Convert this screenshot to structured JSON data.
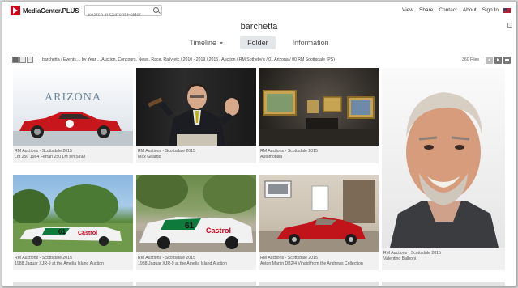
{
  "app": {
    "brand": "MediaCenter.PLUS"
  },
  "search": {
    "placeholder": "Search in Current Folder"
  },
  "topnav": {
    "view": "View",
    "share": "Share",
    "contact": "Contact",
    "about": "About",
    "signin": "Sign In"
  },
  "folder": {
    "title": "barchetta"
  },
  "tabs": {
    "timeline": "Timeline",
    "folder": "Folder",
    "information": "Information"
  },
  "toolbar": {
    "breadcrumb": "barchetta  /  Events ... by Year ... Auction, Concours, News, Race, Rally etc  /  2010 - 2019  /  2015  /  Auction  /  RM Sotheby's  /  01 Arizona  /  00 RM Scottsdale (PS)",
    "file_count": "360 Files"
  },
  "photos": [
    {
      "line1": "RM Auctions - Scottsdale 2015",
      "line2": "Lot 250 1964 Ferrari 250 LM s/n  5899"
    },
    {
      "line1": "RM Auctions - Scottsdale 2015",
      "line2": "Max Girardo"
    },
    {
      "line1": "RM Auctions - Scottsdale 2015",
      "line2": "Automobilia"
    },
    {
      "line1": "RM Auctions - Scottsdale 2015",
      "line2": "Valentino Balboni"
    },
    {
      "line1": "RM Auctions - Scottsdale 2015",
      "line2": "1988 Jaguar XJR-9 at the Amelia Island Auction"
    },
    {
      "line1": "RM Auctions - Scottsdale 2015",
      "line2": "1988 Jaguar XJR-9 at the Amelia Island Auction"
    },
    {
      "line1": "RM Auctions - Scottsdale 2015",
      "line2": "Aston Martin DB2/4 Vinaid from the Andrews Collection"
    }
  ],
  "scene_text": {
    "arizona_banner": "ARIZONA",
    "car_number": "61",
    "sponsor": "Castrol"
  },
  "colors": {
    "brand_red": "#d0021b",
    "active_tab": "#e3e7ea",
    "caption_bg": "#f1f1f1"
  }
}
